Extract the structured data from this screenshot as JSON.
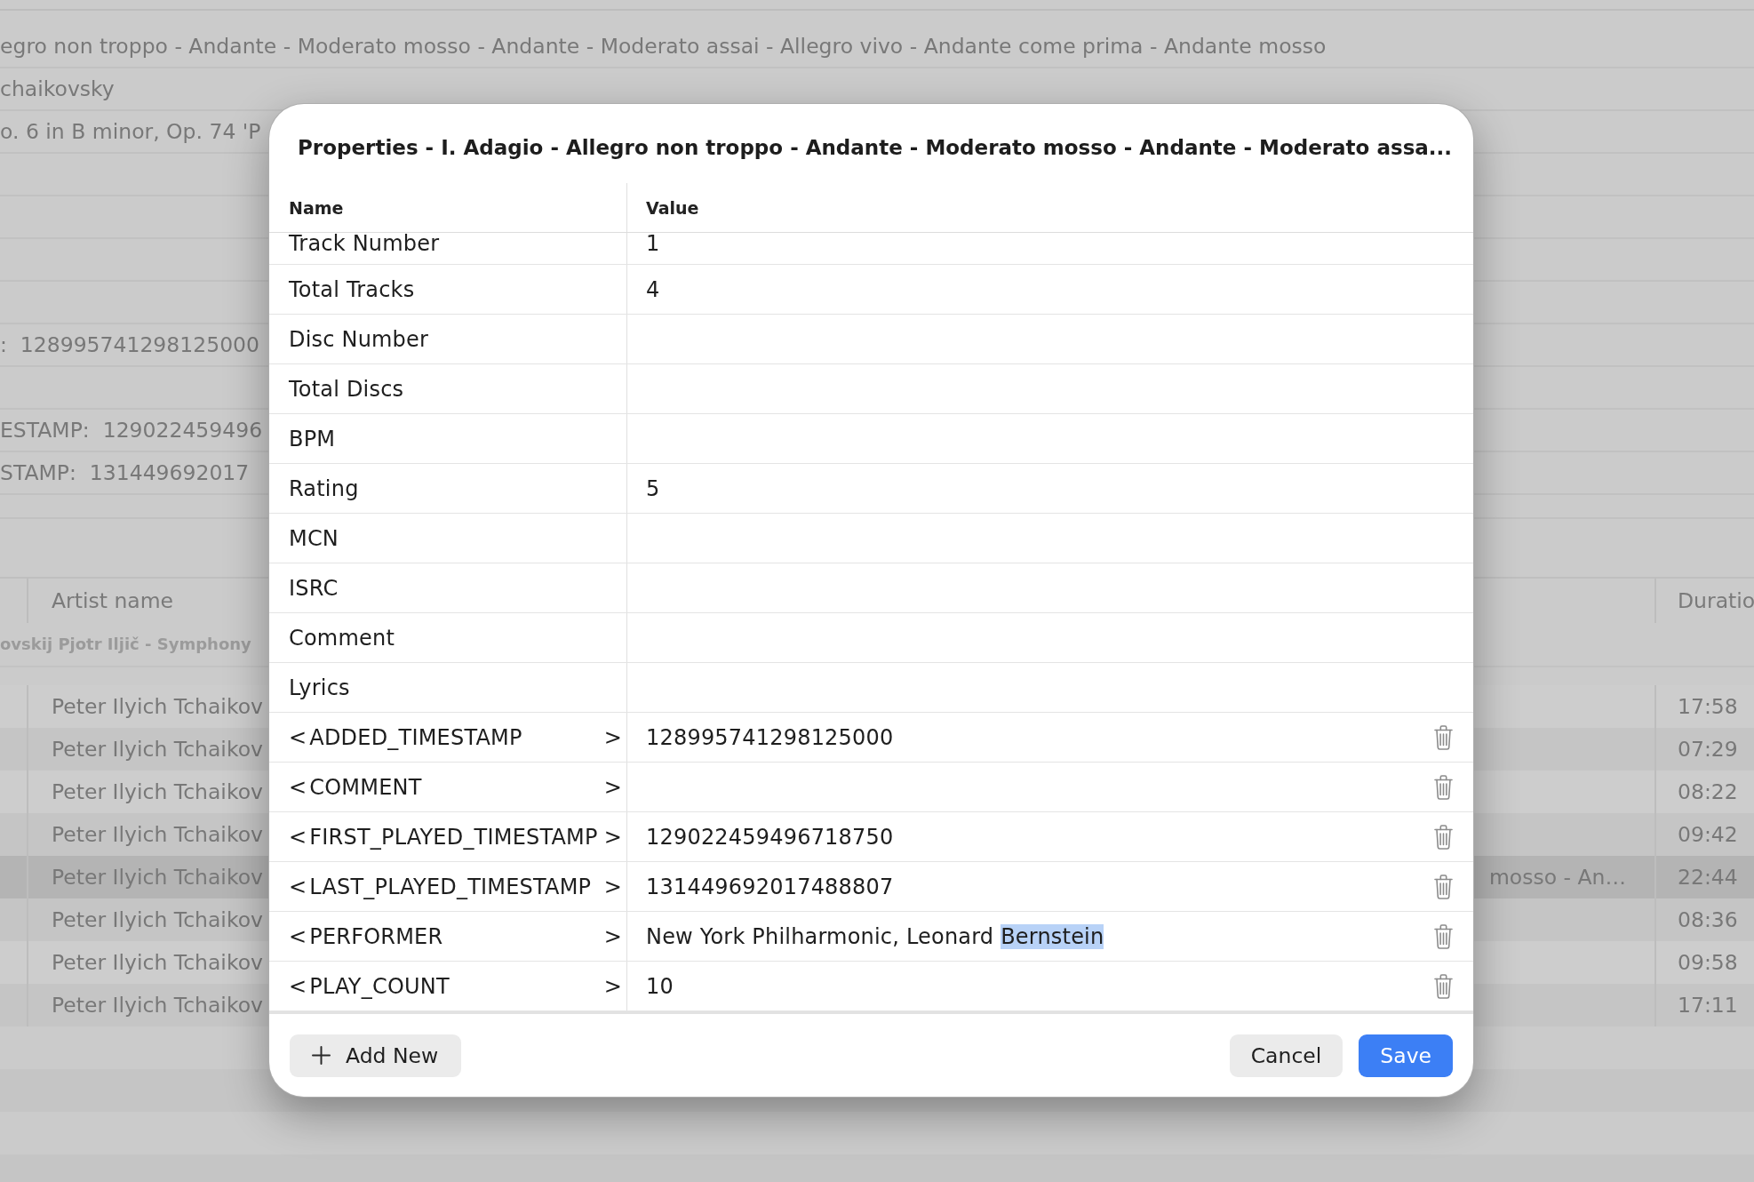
{
  "background": {
    "details": [
      {
        "kind": "text",
        "text": "egro non troppo - Andante - Moderato mosso - Andante - Moderato assai - Allegro vivo - Andante come prima - Andante mosso"
      },
      {
        "kind": "text",
        "text": "chaikovsky"
      },
      {
        "kind": "text",
        "text": "o. 6 in B minor, Op. 74 'P"
      },
      {
        "kind": "blank"
      },
      {
        "kind": "blank"
      },
      {
        "kind": "blank"
      },
      {
        "kind": "blank"
      },
      {
        "kind": "text",
        "text": ":  128995741298125000"
      },
      {
        "kind": "blank"
      },
      {
        "kind": "text",
        "text": "ESTAMP:  129022459496"
      },
      {
        "kind": "text",
        "text": "STAMP:  131449692017"
      }
    ],
    "track_table": {
      "columns": [
        "Artist name",
        "Duratio"
      ],
      "group": "ovskij Pjotr Iljič - Symphony",
      "rows": [
        {
          "artist": "Peter Ilyich Tchaikov",
          "duration": "17:58",
          "selected": false
        },
        {
          "artist": "Peter Ilyich Tchaikov",
          "duration": "07:29",
          "selected": false
        },
        {
          "artist": "Peter Ilyich Tchaikov",
          "duration": "08:22",
          "selected": false
        },
        {
          "artist": "Peter Ilyich Tchaikov",
          "duration": "09:42",
          "selected": false
        },
        {
          "artist": "Peter Ilyich Tchaikov",
          "column_3": "mosso - An…",
          "duration": "22:44",
          "selected": true
        },
        {
          "artist": "Peter Ilyich Tchaikov",
          "duration": "08:36",
          "selected": false
        },
        {
          "artist": "Peter Ilyich Tchaikov",
          "duration": "09:58",
          "selected": false
        },
        {
          "artist": "Peter Ilyich Tchaikov",
          "duration": "17:11",
          "selected": false
        }
      ]
    }
  },
  "dialog": {
    "title": "Properties - I. Adagio - Allegro non troppo - Andante - Moderato mosso - Andante - Moderato assa...",
    "columns": [
      "Name",
      "Value"
    ],
    "rows": [
      {
        "kind": "field",
        "name": "Track Number",
        "value": "1"
      },
      {
        "kind": "field",
        "name": "Total Tracks",
        "value": "4"
      },
      {
        "kind": "field",
        "name": "Disc Number"
      },
      {
        "kind": "field",
        "name": "Total Discs"
      },
      {
        "kind": "field",
        "name": "BPM"
      },
      {
        "kind": "field",
        "name": "Rating",
        "value": "5"
      },
      {
        "kind": "field",
        "name": "MCN"
      },
      {
        "kind": "field",
        "name": "ISRC"
      },
      {
        "kind": "field",
        "name": "Comment"
      },
      {
        "kind": "field",
        "name": "Lyrics"
      },
      {
        "kind": "tag",
        "prefix": "<",
        "name": "ADDED_TIMESTAMP",
        "suffix": ">",
        "value": "128995741298125000"
      },
      {
        "kind": "tag",
        "prefix": "<",
        "name": "COMMENT",
        "suffix": ">"
      },
      {
        "kind": "tag",
        "prefix": "<",
        "name": "FIRST_PLAYED_TIMESTAMP",
        "suffix": ">",
        "value": "129022459496718750"
      },
      {
        "kind": "tag",
        "prefix": "<",
        "name": "LAST_PLAYED_TIMESTAMP",
        "suffix": ">",
        "value": "131449692017488807"
      },
      {
        "kind": "tag",
        "prefix": "<",
        "name": "PERFORMER",
        "suffix": ">",
        "value": "New York Philharmonic, Leonard",
        "selected_text": "Bernstein"
      },
      {
        "kind": "tag",
        "prefix": "<",
        "name": "PLAY_COUNT",
        "suffix": ">",
        "value": "10"
      }
    ],
    "add_button": {
      "label": "Add New"
    },
    "buttons": [
      {
        "kind": "secondary",
        "label": "Cancel"
      },
      {
        "kind": "primary",
        "label": "Save"
      }
    ]
  }
}
